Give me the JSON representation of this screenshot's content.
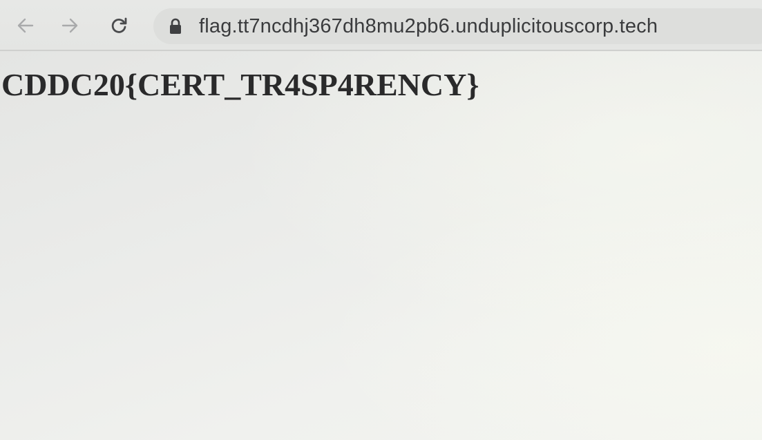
{
  "browser": {
    "back_icon": "back-arrow-icon",
    "forward_icon": "forward-arrow-icon",
    "reload_icon": "reload-icon",
    "lock_icon": "lock-icon",
    "url": "flag.tt7ncdhj367dh8mu2pb6.unduplicitouscorp.tech"
  },
  "page": {
    "heading": "CDDC20{CERT_TR4SP4RENCY}"
  }
}
